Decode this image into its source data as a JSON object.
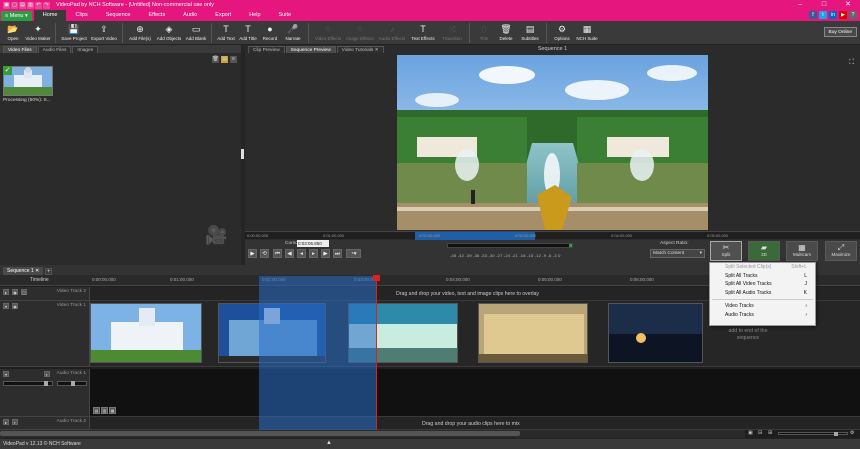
{
  "window": {
    "title": "VideoPad by NCH Software - [Untitled] Non-commercial use only",
    "controls": [
      "–",
      "□",
      "✕"
    ]
  },
  "menubar": {
    "menu_button": "≡ Menu ▾",
    "tabs": [
      "Home",
      "Clips",
      "Sequence",
      "Effects",
      "Audio",
      "Export",
      "Help",
      "Suite"
    ],
    "active_tab": "Home",
    "social": [
      "f",
      "t",
      "in",
      "▶",
      "?"
    ]
  },
  "toolbar": {
    "items": [
      {
        "label": "Open",
        "icon": "folder-icon",
        "glyph": "📂",
        "enabled": true
      },
      {
        "label": "Video Maker",
        "icon": "wand-icon",
        "glyph": "✦",
        "enabled": true
      },
      {
        "label": "Save Project",
        "icon": "save-icon",
        "glyph": "💾",
        "enabled": true
      },
      {
        "label": "Export Video",
        "icon": "export-icon",
        "glyph": "⇪",
        "enabled": true
      },
      {
        "label": "Add File(s)",
        "icon": "add-file-icon",
        "glyph": "⊕",
        "enabled": true
      },
      {
        "label": "Add Objects",
        "icon": "objects-icon",
        "glyph": "◈",
        "enabled": true
      },
      {
        "label": "Add Blank",
        "icon": "blank-icon",
        "glyph": "▭",
        "enabled": true
      },
      {
        "label": "Add Text",
        "icon": "text-icon",
        "glyph": "T",
        "enabled": true
      },
      {
        "label": "Add Title",
        "icon": "title-icon",
        "glyph": "T",
        "enabled": true
      },
      {
        "label": "Record",
        "icon": "record-icon",
        "glyph": "●",
        "enabled": true
      },
      {
        "label": "Narrate",
        "icon": "mic-icon",
        "glyph": "🎤",
        "enabled": true
      },
      {
        "label": "Video Effects",
        "icon": "video-effects-icon",
        "glyph": "✧",
        "enabled": false
      },
      {
        "label": "Image Effects",
        "icon": "image-effects-icon",
        "glyph": "✧",
        "enabled": false
      },
      {
        "label": "Audio Effects",
        "icon": "audio-effects-icon",
        "glyph": "♪",
        "enabled": false
      },
      {
        "label": "Text Effects",
        "icon": "text-effects-icon",
        "glyph": "T",
        "enabled": true
      },
      {
        "label": "Transition",
        "icon": "transition-icon",
        "glyph": "⤨",
        "enabled": false
      },
      {
        "label": "Trim",
        "icon": "trim-icon",
        "glyph": "⌷",
        "enabled": false
      },
      {
        "label": "Delete",
        "icon": "delete-icon",
        "glyph": "🗑",
        "enabled": true
      },
      {
        "label": "Subtitles",
        "icon": "subtitles-icon",
        "glyph": "▤",
        "enabled": true
      },
      {
        "label": "Options",
        "icon": "options-icon",
        "glyph": "⚙",
        "enabled": true
      },
      {
        "label": "NCH Suite",
        "icon": "suite-icon",
        "glyph": "▦",
        "enabled": true
      }
    ],
    "buy_online": "Buy Online"
  },
  "media_panel": {
    "tabs": [
      "Video Files",
      "Audio Files",
      "Images"
    ],
    "active_tab": "Video Files",
    "item_label": "Processing (50%): S..."
  },
  "preview": {
    "tabs": [
      "Clip Preview",
      "Sequence Preview",
      "Video Tutorials ✕"
    ],
    "active_tab": "Sequence Preview",
    "title": "Sequence 1",
    "ruler_ticks": [
      "0:00:00.000",
      "0:01:00.000",
      "0:02:00.000",
      "0:03:00.000",
      "0:04:00.000",
      "0:05:00.000"
    ],
    "cursor_label": "Cursor:",
    "cursor_value": "0:03:06.850",
    "meter_scale": "-45 -42 -39 -36 -33 -30 -27 -24 -21 -18 -15 -12 -9 -6 -3 0",
    "aspect_label": "Aspect Ratio:",
    "aspect_value": "Match Content",
    "buttons": [
      "Split",
      "3D",
      "Multicam",
      "Maximize"
    ]
  },
  "split_menu": {
    "items": [
      {
        "label": "Split Selected Clip(s)",
        "shortcut": "Shift+L",
        "enabled": false
      },
      {
        "label": "Split All Tracks",
        "shortcut": "L",
        "enabled": true
      },
      {
        "label": "Split All Video Tracks",
        "shortcut": "J",
        "enabled": true
      },
      {
        "label": "Split All Audio Tracks",
        "shortcut": "K",
        "enabled": true
      },
      {
        "label": "Video Tracks",
        "shortcut": "›",
        "enabled": true
      },
      {
        "label": "Audio Tracks",
        "shortcut": "›",
        "enabled": true
      }
    ]
  },
  "timeline": {
    "sequence_tab": "Sequence 1 ✕",
    "add_tab": "+",
    "label": "Timeline",
    "ruler_ticks": [
      "0:00:00.000",
      "0:01:00.000",
      "0:02:00.000",
      "0:03:00.000",
      "0:04:00.000",
      "0:05:00.000",
      "0:06:00.000",
      "0:07:00.000"
    ],
    "overlay_track": "Video Track 2",
    "overlay_drop": "Drag and drop your video, text and image clips here to overlay",
    "video_track": "Video Track 1",
    "video_drop": "Drag and drop here to add to end of the sequence",
    "audio_track": "Audio Track 1",
    "audio_track2": "Audio Track 2",
    "audio_drop": "Drag and drop your audio clips here to mix"
  },
  "statusbar": {
    "text": "VideoPad v 12.13 © NCH Software",
    "arrow": "▲"
  }
}
